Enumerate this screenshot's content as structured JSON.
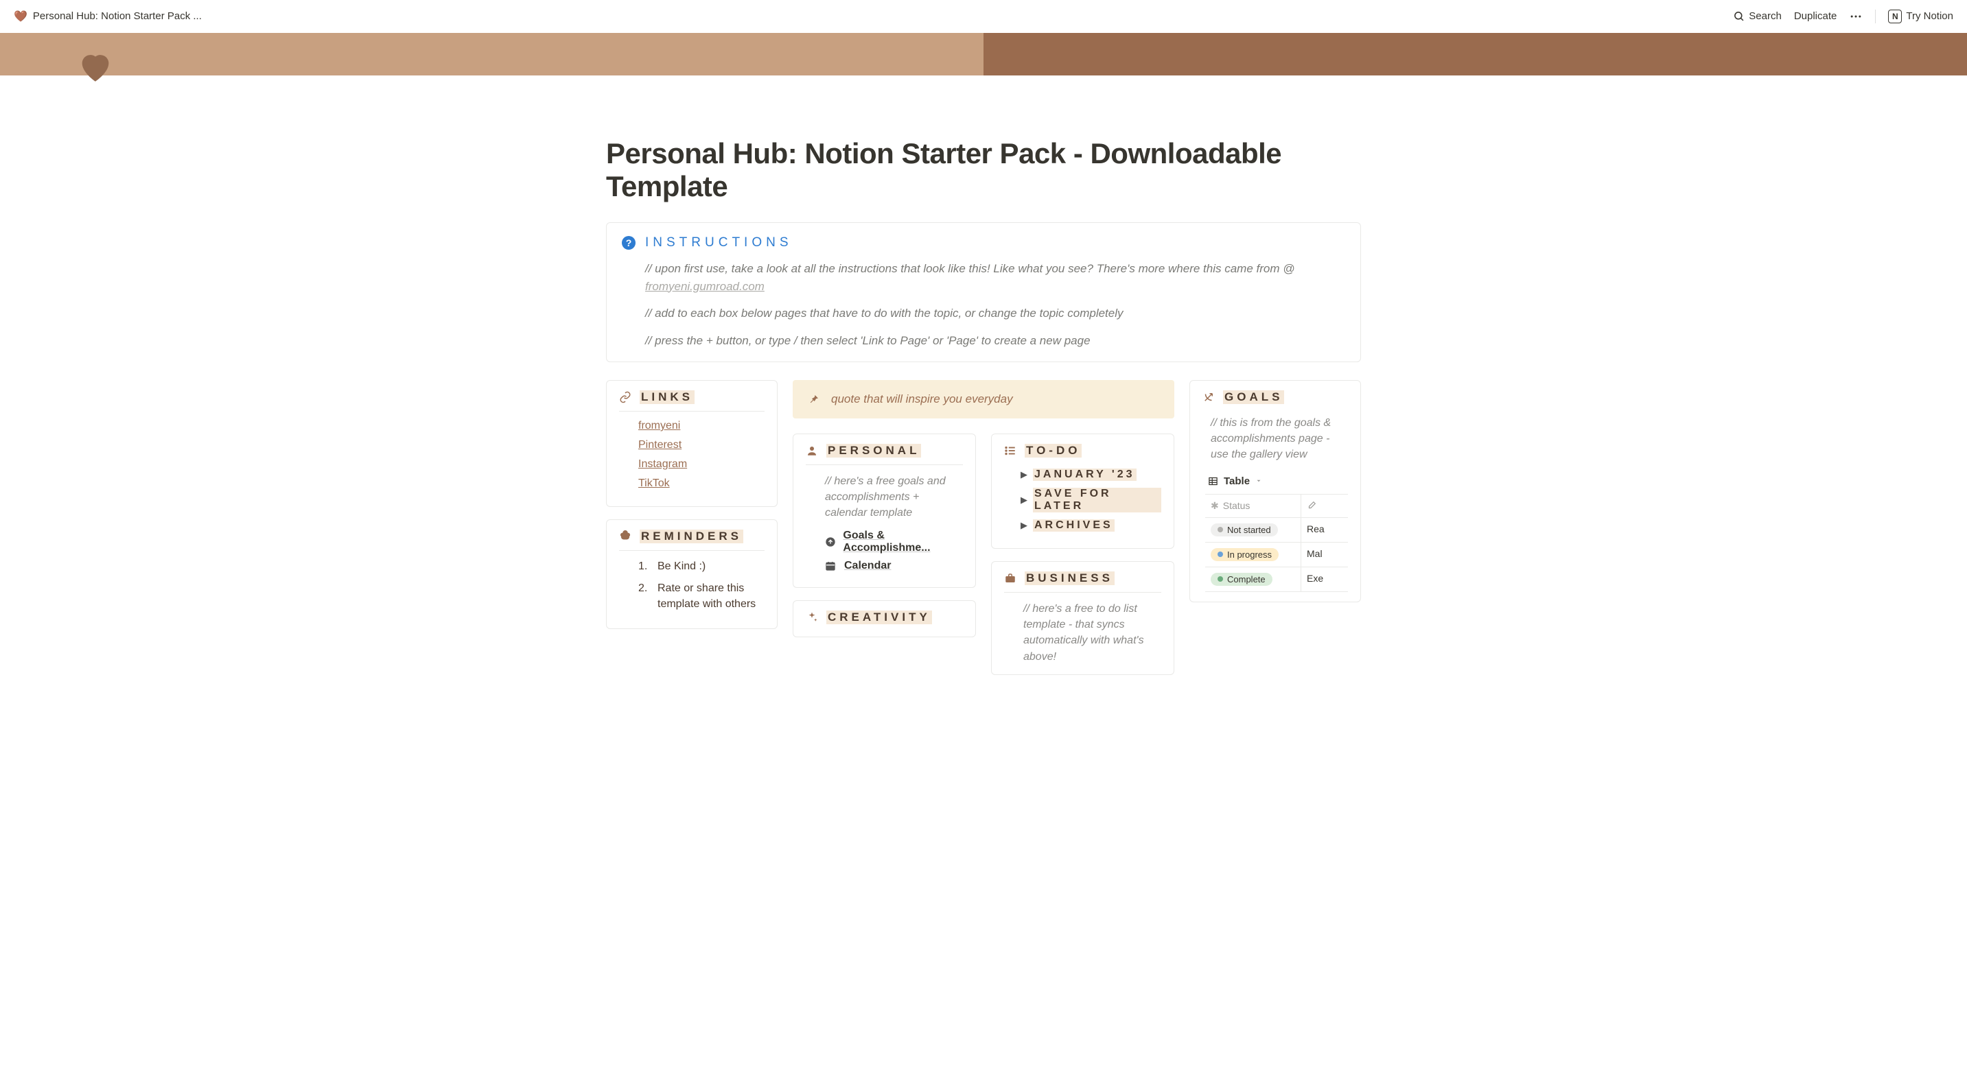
{
  "topbar": {
    "title": "Personal Hub: Notion Starter Pack ...",
    "search": "Search",
    "duplicate": "Duplicate",
    "try": "Try Notion"
  },
  "page": {
    "title": "Personal Hub: Notion Starter Pack - Downloadable Template"
  },
  "instructions": {
    "label": "INSTRUCTIONS",
    "line1_prefix": "// upon first use, take a look at all the instructions that look like this! Like what you see? There's more where this came from @ ",
    "line1_link": "fromyeni.gumroad.com",
    "line2": "// add to each box below pages that have to do with the topic, or change the topic completely",
    "line3": "// press the + button, or type / then select 'Link to Page' or 'Page' to create a new page"
  },
  "links": {
    "label": "LINKS",
    "items": [
      "fromyeni",
      "Pinterest",
      "Instagram",
      "TikTok"
    ]
  },
  "reminders": {
    "label": "REMINDERS",
    "items": [
      "Be Kind :)",
      "Rate or share this template with others"
    ]
  },
  "quote": {
    "text": "quote that will inspire you everyday"
  },
  "personal": {
    "label": "PERSONAL",
    "note": "// here's a free goals and accomplishments + calendar template",
    "pages": [
      {
        "icon": "↑",
        "label": "Goals & Accomplishme..."
      },
      {
        "icon": "📅",
        "label": "Calendar"
      }
    ]
  },
  "creativity": {
    "label": "CREATIVITY"
  },
  "todo": {
    "label": "TO-DO",
    "items": [
      "JANUARY '23",
      "SAVE FOR LATER",
      "ARCHIVES"
    ]
  },
  "business": {
    "label": "BUSINESS",
    "note": "// here's a free to do list template - that syncs automatically with what's above!"
  },
  "goals": {
    "label": "GOALS",
    "note": "// this is from the goals & accomplishments page - use the gallery view",
    "view": "Table",
    "columns": {
      "status": "Status"
    },
    "rows": [
      {
        "status": "Not started",
        "style": "default",
        "title": "Rea"
      },
      {
        "status": "In progress",
        "style": "progress",
        "title": "Mal"
      },
      {
        "status": "Complete",
        "style": "complete",
        "title": "Exe"
      }
    ]
  }
}
